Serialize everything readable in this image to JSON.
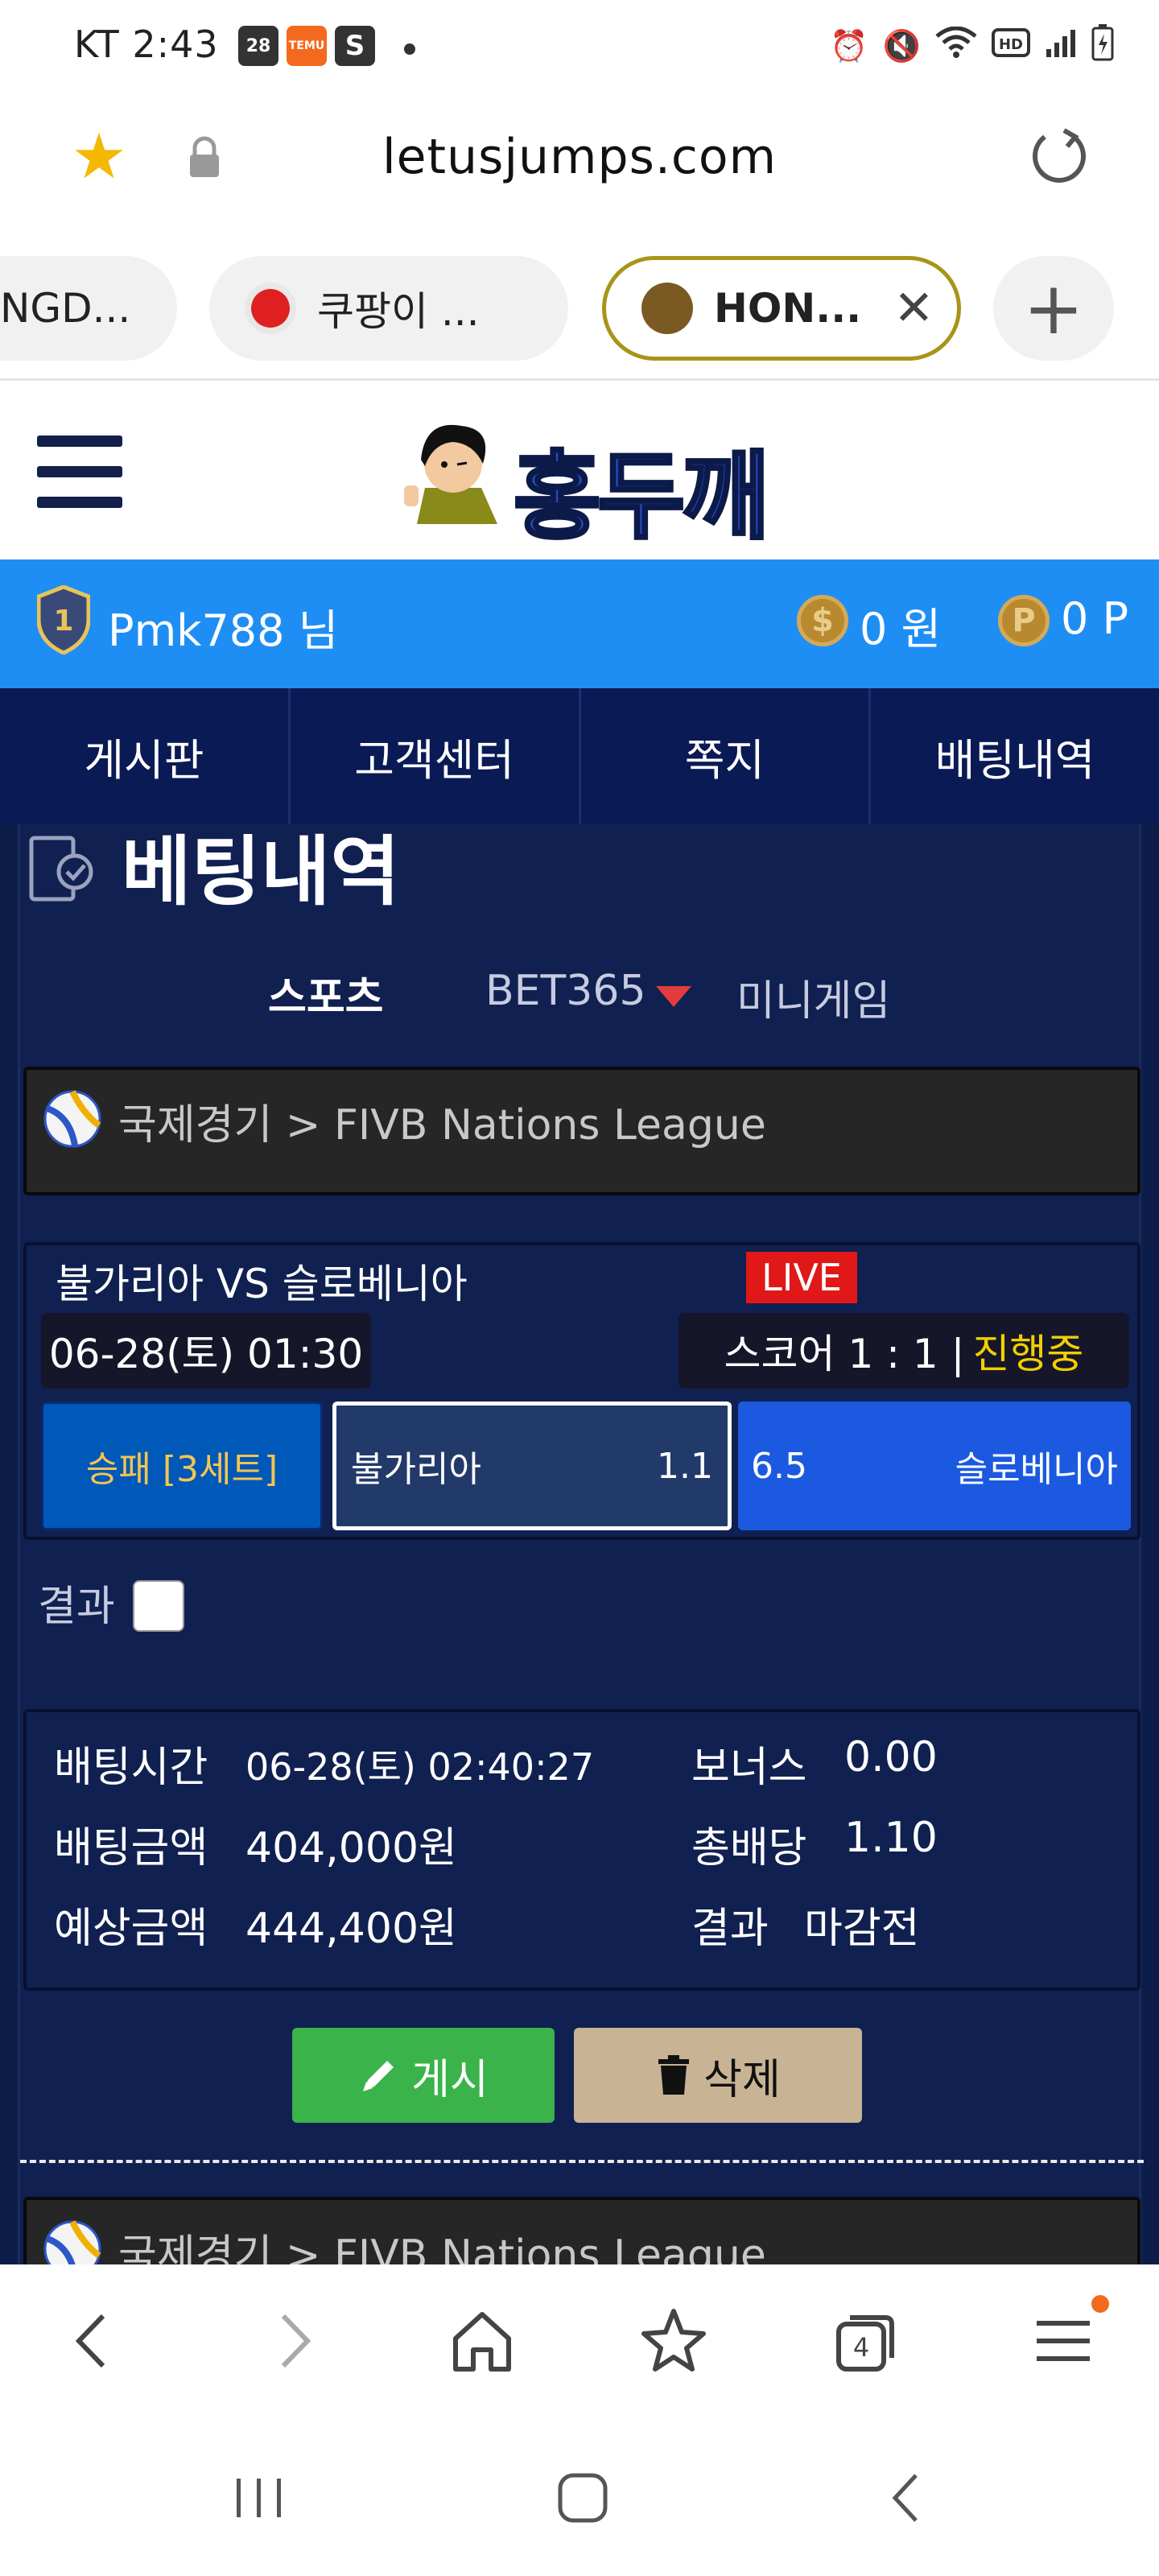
{
  "status": {
    "time": "KT 2:43",
    "calendar_badge": "28",
    "temu_badge": "TEMU",
    "s_badge": "S"
  },
  "browser": {
    "url": "letusjumps.com",
    "tabs": [
      {
        "label": "NGD..."
      },
      {
        "label": "쿠팡이 ..."
      },
      {
        "label": "HON..."
      }
    ]
  },
  "site": {
    "logo_text": "홍두깨",
    "user": {
      "name": "Pmk788 님",
      "cash": "0 원",
      "point": "0 P",
      "cash_symbol": "$",
      "point_symbol": "P"
    },
    "nav": [
      "게시판",
      "고객센터",
      "쪽지",
      "배팅내역"
    ]
  },
  "page": {
    "title": "베팅내역",
    "subtabs": [
      "스포츠",
      "BET365",
      "미니게임"
    ]
  },
  "bet": {
    "league": "국제경기 > FIVB Nations League",
    "teams": "불가리아 VS 슬로베니아",
    "live": "LIVE",
    "date": "06-28(토) 01:30",
    "score": "스코어 1 : 1 |",
    "progress": "진행중",
    "market": "승패 [3세트]",
    "home_name": "불가리아",
    "home_odd": "1.1",
    "away_odd": "6.5",
    "away_name": "슬로베니아",
    "result_label": "결과",
    "details": {
      "bet_time_label": "배팅시간",
      "bet_time": "06-28(토) 02:40:27",
      "bonus_label": "보너스",
      "bonus": "0.00",
      "amount_label": "배팅금액",
      "amount": "404,000원",
      "total_odds_label": "총배당",
      "total_odds": "1.10",
      "expected_label": "예상금액",
      "expected": "444,400원",
      "result_label": "결과",
      "result": "마감전"
    },
    "post_button": "게시",
    "delete_button": "삭제"
  },
  "next_bet": {
    "league": "국제경기 > FIVB Nations League"
  },
  "browser_toolbar": {
    "tab_count": "4"
  },
  "colors": {
    "userbar": "#1e8ef5",
    "nav": "#0a1a55",
    "content_bg": "#102050",
    "live": "#e01818",
    "progress": "#f0d000",
    "post": "#3ab34a",
    "delete": "#c8b495"
  }
}
